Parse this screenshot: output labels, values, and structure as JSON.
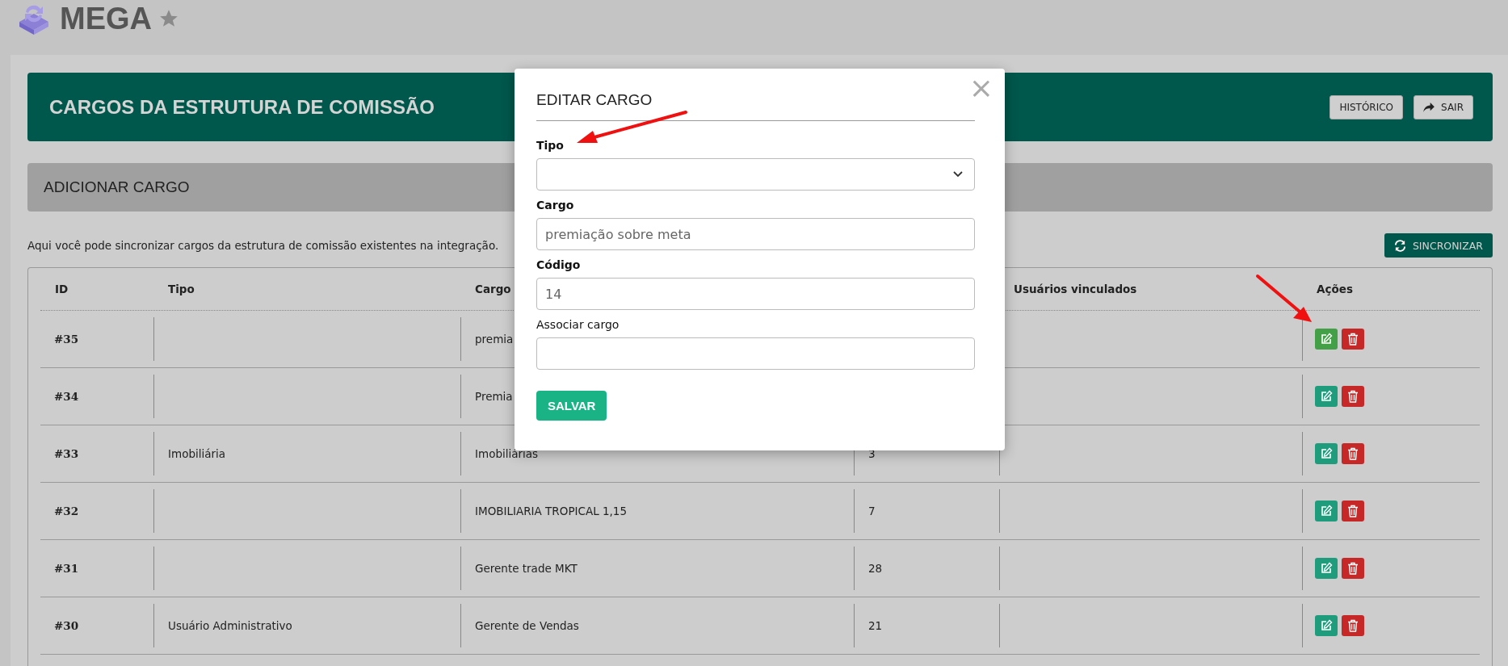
{
  "app": {
    "name": "MEGA",
    "favorite": false
  },
  "header": {
    "title": "CARGOS DA ESTRUTURA DE COMISSÃO",
    "buttons": [
      {
        "label": "HISTÓRICO",
        "kind": "plain"
      },
      {
        "label": "SAIR",
        "kind": "with_icon"
      }
    ]
  },
  "add_section": {
    "title": "ADICIONAR CARGO"
  },
  "description": "Aqui você pode sincronizar cargos da estrutura de comissão existentes na integração.",
  "sync_button": "SINCRONIZAR",
  "table": {
    "columns": [
      "ID",
      "Tipo",
      "Cargo",
      null,
      "Usuários vinculados",
      "Ações"
    ],
    "rows": [
      {
        "id": "#35",
        "cargo": "premia",
        "hovered": true
      },
      {
        "id": "#34",
        "cargo": "Premia",
        "hovered": false
      },
      {
        "id": "#33",
        "tipo": "Imobiliária",
        "cargo": "Imobiliárias",
        "column_4": "3",
        "hovered": false
      },
      {
        "id": "#32",
        "cargo": "IMOBILIARIA TROPICAL 1,15",
        "column_4": "7",
        "hovered": false
      },
      {
        "id": "#31",
        "cargo": "Gerente trade MKT",
        "column_4": "28",
        "hovered": false
      },
      {
        "id": "#30",
        "tipo": "Usuário Administrativo",
        "cargo": "Gerente de Vendas",
        "column_4": "21",
        "hovered": false
      }
    ]
  },
  "modal": {
    "title": "EDITAR CARGO",
    "close": "×",
    "fields": [
      {
        "kind": "select",
        "label": "Tipo",
        "required": true
      },
      {
        "kind": "text",
        "label": "Cargo",
        "required": true,
        "value": "premiação sobre meta"
      },
      {
        "kind": "text",
        "label": "Código",
        "required": true,
        "value": "14"
      },
      {
        "kind": "text",
        "label": "Associar cargo",
        "required": false
      }
    ],
    "save_button": "SALVAR"
  }
}
